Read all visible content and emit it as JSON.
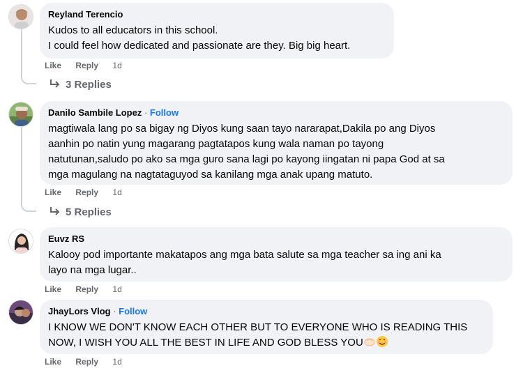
{
  "comments": [
    {
      "author": "Reyland Terencio",
      "follow": "",
      "lines": [
        "Kudos to all educators in this school.",
        "I could feel how dedicated and passionate are they. Big big heart."
      ],
      "like": "Like",
      "reply": "Reply",
      "time": "1d",
      "replies": "3 Replies"
    },
    {
      "author": "Danilo Sambile Lopez",
      "follow": "Follow",
      "lines": [
        "magtiwala lang po sa bigay ng Diyos kung saan tayo nararapat,Dakila po ang Diyos",
        "aanhin po natin yung magarang pagtatapos kung wala naman po tayong",
        "natutunan,saludo po ako sa mga guro sana lagi po kayong iingatan ni papa God at sa",
        "mga magulang na nagtataguyod sa kanilang mga anak upang matuto."
      ],
      "like": "Like",
      "reply": "Reply",
      "time": "1d",
      "replies": "5 Replies"
    },
    {
      "author": "Euvz RS",
      "follow": "",
      "lines": [
        "Kalooy pod importante makatapos ang mga bata salute sa mga teacher sa ing ani ka",
        "layo na mga lugar.."
      ],
      "like": "Like",
      "reply": "Reply",
      "time": "1d"
    },
    {
      "author": "JhayLors Vlog",
      "follow": "Follow",
      "lines": [
        "I KNOW WE DON'T KNOW EACH OTHER BUT TO EVERYONE WHO IS READING THIS",
        "NOW, I WISH YOU ALL THE BEST IN LIFE AND GOD BLESS YOU"
      ],
      "like": "Like",
      "reply": "Reply",
      "time": "1d"
    }
  ],
  "separator": " · ",
  "colors": {
    "bubble": "#f0f2f5",
    "link": "#1877f2",
    "meta": "#65676b",
    "text": "#050505"
  },
  "icons": [
    "reply-arrow-icon",
    "clap-emoji-icon",
    "smiling-emoji-icon"
  ]
}
